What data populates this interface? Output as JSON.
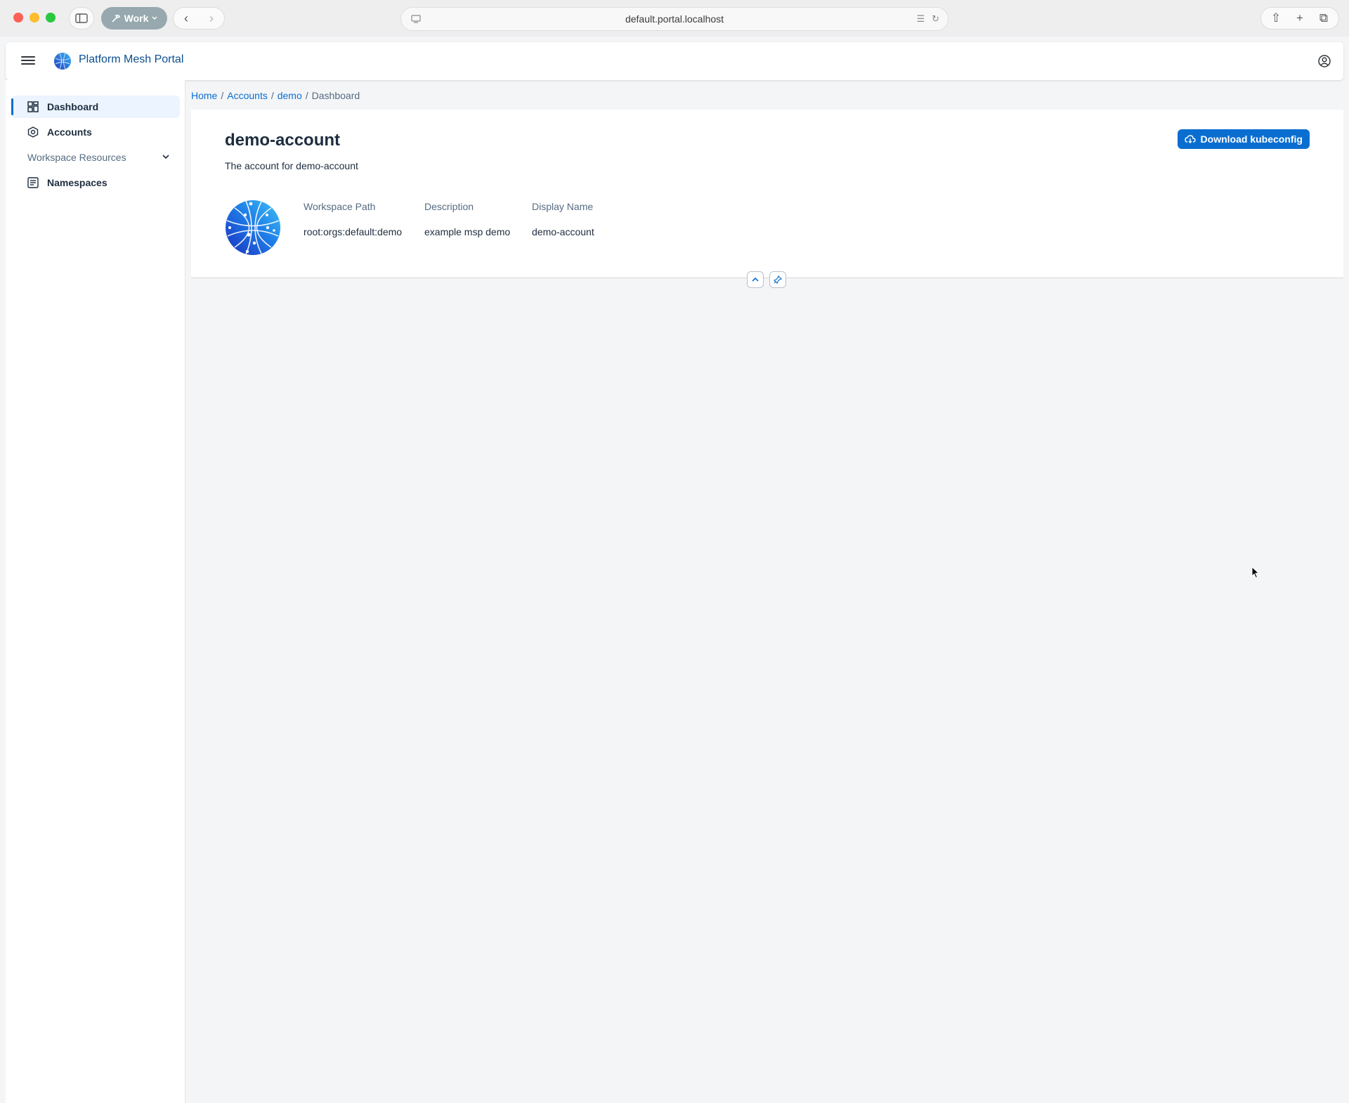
{
  "browser": {
    "profile_label": "Work",
    "url": "default.portal.localhost"
  },
  "app": {
    "title": "Platform Mesh Portal"
  },
  "sidebar": {
    "items": [
      {
        "label": "Dashboard",
        "icon": "dashboard-icon",
        "active": true
      },
      {
        "label": "Accounts",
        "icon": "accounts-icon",
        "active": false
      },
      {
        "label": "Workspace Resources",
        "icon": "chevron-down-icon",
        "group": true
      },
      {
        "label": "Namespaces",
        "icon": "namespaces-icon",
        "active": false
      }
    ]
  },
  "breadcrumb": {
    "items": [
      "Home",
      "Accounts",
      "demo"
    ],
    "current": "Dashboard"
  },
  "header": {
    "title": "demo-account",
    "subtitle": "The account for demo-account",
    "download_label": "Download kubeconfig",
    "facets": [
      {
        "label": "Workspace Path",
        "value": "root:orgs:default:demo"
      },
      {
        "label": "Description",
        "value": "example msp demo"
      },
      {
        "label": "Display Name",
        "value": "demo-account"
      }
    ]
  },
  "colors": {
    "accent": "#0a6ed1",
    "background": "#f4f5f7",
    "active_nav": "#ebf4ff"
  }
}
